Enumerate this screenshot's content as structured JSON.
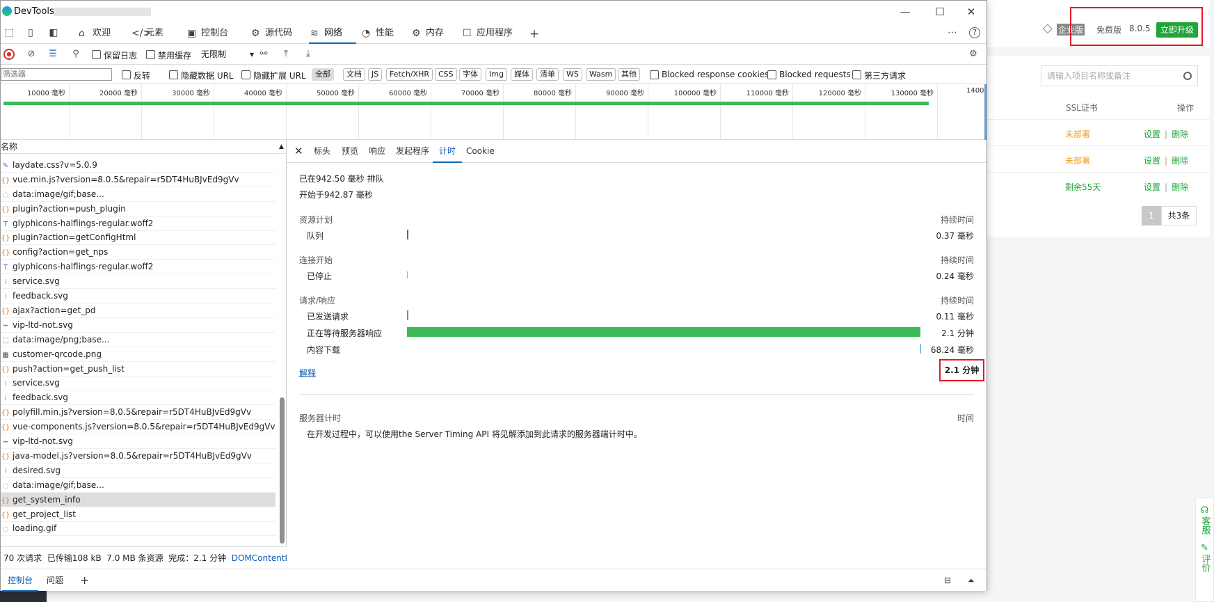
{
  "window": {
    "title": "DevTools -",
    "min": "—",
    "max": "☐",
    "close": "✕"
  },
  "main_tabs": [
    {
      "label": "欢迎",
      "glyph": "⌂"
    },
    {
      "label": "元素",
      "glyph": "</>"
    },
    {
      "label": "控制台",
      "glyph": "▣"
    },
    {
      "label": "源代码",
      "glyph": "⚙"
    },
    {
      "label": "网络",
      "glyph": "≋"
    },
    {
      "label": "性能",
      "glyph": "◔"
    },
    {
      "label": "内存",
      "glyph": "⚙"
    },
    {
      "label": "应用程序",
      "glyph": "☐"
    }
  ],
  "toolbar": {
    "preserve_log": "保留日志",
    "disable_cache": "禁用缓存",
    "throttle": "无限制",
    "filter_placeholder": "筛选器",
    "invert": "反转",
    "hide_data_url": "隐藏数据 URL",
    "hide_ext_url": "隐藏扩展 URL",
    "filter_types": [
      "全部",
      "文档",
      "JS",
      "Fetch/XHR",
      "CSS",
      "字体",
      "Img",
      "媒体",
      "清单",
      "WS",
      "Wasm",
      "其他"
    ],
    "blocked_cookies": "Blocked response cookies",
    "blocked_requests": "Blocked requests",
    "third_party": "第三方请求"
  },
  "overview_ticks": [
    "10000 毫秒",
    "20000 毫秒",
    "30000 毫秒",
    "40000 毫秒",
    "50000 毫秒",
    "60000 毫秒",
    "70000 毫秒",
    "80000 毫秒",
    "90000 毫秒",
    "100000 毫秒",
    "110000 毫秒",
    "120000 毫秒",
    "130000 毫秒",
    "1400"
  ],
  "request_list": {
    "header": "名称",
    "items": [
      {
        "name": "ajax?action=get_pd",
        "icon": "{}"
      },
      {
        "name": "laydate.css?v=5.0.9",
        "icon": "✎"
      },
      {
        "name": "vue.min.js?version=8.0.5&repair=r5DT4HuBJvEd9gVv",
        "icon": "{}"
      },
      {
        "name": "data:image/gif;base...",
        "icon": "◌"
      },
      {
        "name": "plugin?action=push_plugin",
        "icon": "{}"
      },
      {
        "name": "glyphicons-halflings-regular.woff2",
        "icon": "T"
      },
      {
        "name": "plugin?action=getConfigHtml",
        "icon": "{}"
      },
      {
        "name": "config?action=get_nps",
        "icon": "{}"
      },
      {
        "name": "glyphicons-halflings-regular.woff2",
        "icon": "T"
      },
      {
        "name": "service.svg",
        "icon": "⁞"
      },
      {
        "name": "feedback.svg",
        "icon": "⁞"
      },
      {
        "name": "ajax?action=get_pd",
        "icon": "{}"
      },
      {
        "name": "vip-ltd-not.svg",
        "icon": "━"
      },
      {
        "name": "data:image/png;base...",
        "icon": "⬚"
      },
      {
        "name": "customer-qrcode.png",
        "icon": "▦"
      },
      {
        "name": "push?action=get_push_list",
        "icon": "{}"
      },
      {
        "name": "service.svg",
        "icon": "⁞"
      },
      {
        "name": "feedback.svg",
        "icon": "⁞"
      },
      {
        "name": "polyfill.min.js?version=8.0.5&repair=r5DT4HuBJvEd9gVv",
        "icon": "{}"
      },
      {
        "name": "vue-components.js?version=8.0.5&repair=r5DT4HuBJvEd9gVv",
        "icon": "{}"
      },
      {
        "name": "vip-ltd-not.svg",
        "icon": "━"
      },
      {
        "name": "java-model.js?version=8.0.5&repair=r5DT4HuBJvEd9gVv",
        "icon": "{}"
      },
      {
        "name": "desired.svg",
        "icon": "⁞"
      },
      {
        "name": "data:image/gif;base...",
        "icon": "◌"
      },
      {
        "name": "get_system_info",
        "icon": "{}"
      },
      {
        "name": "get_project_list",
        "icon": "{}"
      },
      {
        "name": "loading.gif",
        "icon": "◌"
      }
    ],
    "selected_index": 24
  },
  "status": {
    "requests": "70 次请求",
    "transferred": "已传输108 kB",
    "resources": "7.0 MB 条资源",
    "finish": "完成：2.1 分钟",
    "dom": "DOMContentLoade"
  },
  "detail_tabs": [
    "标头",
    "预览",
    "响应",
    "发起程序",
    "计时",
    "Cookie"
  ],
  "timing": {
    "queued_at": "已在942.50 毫秒 排队",
    "started_at": "开始于942.87 毫秒",
    "duration_header": "持续时间",
    "sections": [
      {
        "title": "资源计划",
        "rows": [
          {
            "label": "队列",
            "value": "0.37 毫秒"
          }
        ]
      },
      {
        "title": "连接开始",
        "rows": [
          {
            "label": "已停止",
            "value": "0.24 毫秒"
          }
        ]
      },
      {
        "title": "请求/响应",
        "rows": [
          {
            "label": "已发送请求",
            "value": "0.11 毫秒"
          },
          {
            "label": "正在等待服务器响应",
            "value": "2.1 分钟"
          },
          {
            "label": "内容下载",
            "value": "68.24 毫秒"
          }
        ]
      }
    ],
    "explain": "解释",
    "total": "2.1 分钟",
    "server_timing_title": "服务器计时",
    "time_header": "时间",
    "server_timing_desc": "在开发过程中，可以使用the Server Timing API 将见解添加到此请求的服务器端计时中。"
  },
  "drawer_tabs": [
    "控制台",
    "问题"
  ],
  "background": {
    "edition": "企业版",
    "free": "免费版",
    "version": "8.0.5",
    "upgrade": "立即升级",
    "search_placeholder": "请输入项目名称或备注",
    "col_ssl": "SSL证书",
    "col_ops": "操作",
    "rows": [
      {
        "status": "未部署",
        "color": "#f0a020"
      },
      {
        "status": "未部署",
        "color": "#f0a020"
      },
      {
        "status": "剩余55天",
        "color": "#20a53a"
      }
    ],
    "op_set": "设置",
    "op_sep": "|",
    "op_del": "删除",
    "page": "1",
    "total": "共3条",
    "side_service": "客服",
    "side_review": "评价"
  }
}
